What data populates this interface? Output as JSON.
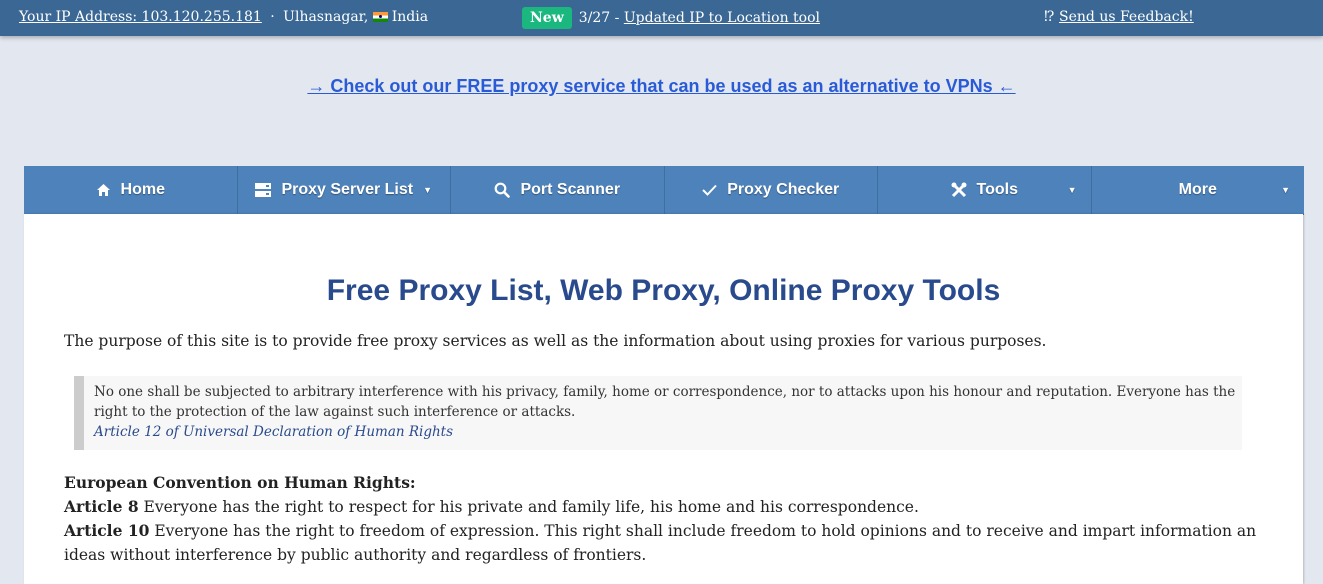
{
  "topbar": {
    "ip_label": "Your IP Address: 103.120.255.181",
    "separator": "·",
    "city": "Ulhasnagar,",
    "country": "India",
    "news_badge": "New",
    "news_date": "3/27 -",
    "news_link": "Updated IP to Location tool",
    "feedback_prefix": "⁉",
    "feedback_link": "Send us Feedback!"
  },
  "promo": {
    "text": "→ Check out our FREE proxy service that can be used as an alternative to VPNs ←"
  },
  "nav": {
    "items": [
      {
        "label": "Home",
        "icon": "home-icon"
      },
      {
        "label": "Proxy Server List",
        "icon": "server-icon",
        "dropdown": true
      },
      {
        "label": "Port Scanner",
        "icon": "search-icon"
      },
      {
        "label": "Proxy Checker",
        "icon": "check-icon"
      },
      {
        "label": "Tools",
        "icon": "tools-icon",
        "dropdown": true
      },
      {
        "label": "More",
        "dropdown": true
      }
    ],
    "caret": "▼"
  },
  "main": {
    "title": "Free Proxy List, Web Proxy, Online Proxy Tools",
    "intro": "The purpose of this site is to provide free proxy services as well as the information about using proxies for various purposes.",
    "quote": {
      "text": "No one shall be subjected to arbitrary interference with his privacy, family, home or correspondence, nor to attacks upon his honour and reputation. Everyone has the right to the protection of the law against such interference or attacks.",
      "cite": "Article 12 of Universal Declaration of Human Rights"
    },
    "echr": {
      "heading": "European Convention on Human Rights:",
      "articles": [
        {
          "label": "Article 8",
          "text": " Everyone has the right to respect for his private and family life, his home and his correspondence."
        },
        {
          "label": "Article 10",
          "text": " Everyone has the right to freedom of expression. This right shall include freedom to hold opinions and to receive and impart information an ideas without interference by public authority and regardless of frontiers."
        }
      ]
    }
  },
  "colors": {
    "topbar_bg": "#3a6794",
    "nav_bg": "#4e82ba",
    "badge_green": "#1ab77f",
    "title_blue": "#294a8c",
    "promo_link": "#2a5bd7",
    "page_bg": "#e3e7ef"
  }
}
